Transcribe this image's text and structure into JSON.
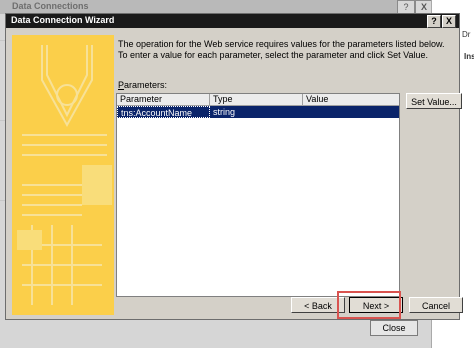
{
  "background_dialog": {
    "title": "Data Connections",
    "help_glyph": "?",
    "close_glyph": "X",
    "close_button": "Close"
  },
  "right_panel": {
    "label_top": "Dr",
    "label_section": "Ins"
  },
  "wizard": {
    "title": "Data Connection Wizard",
    "help_glyph": "?",
    "close_glyph": "X",
    "description": "The operation for the Web service requires values for the parameters listed below. To enter a value for each parameter, select the parameter and click Set Value.",
    "parameters_label_prefix": "P",
    "parameters_label_rest": "arameters:",
    "columns": [
      "Parameter",
      "Type",
      "Value"
    ],
    "rows": [
      {
        "parameter": "tns:AccountName",
        "type": "string",
        "value": ""
      }
    ],
    "set_value_button": "Set Value...",
    "back_button": "< Back",
    "next_button": "Next >",
    "cancel_button": "Cancel"
  },
  "colors": {
    "side_panel": "#fbcf4a",
    "selection": "#0a246a",
    "highlight": "#d9534f"
  }
}
